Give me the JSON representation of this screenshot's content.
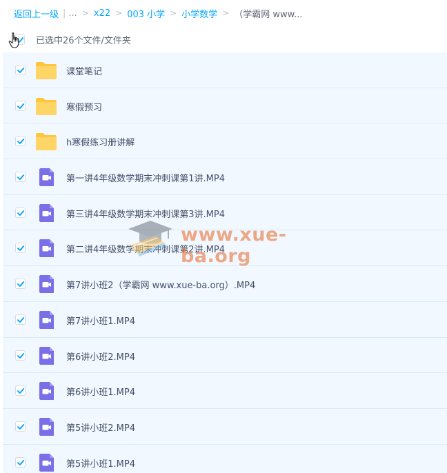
{
  "breadcrumb": {
    "back": "返回上一级",
    "ellipsis": "...",
    "items": [
      "x22",
      "003 小学",
      "小学数学"
    ],
    "current": "（学霸网 www..."
  },
  "selection": {
    "text": "已选中26个文件/文件夹"
  },
  "files": [
    {
      "name": "课堂笔记",
      "type": "folder"
    },
    {
      "name": "寒假预习",
      "type": "folder"
    },
    {
      "name": "h寒假练习册讲解",
      "type": "folder"
    },
    {
      "name": "第一讲4年级数学期末冲刺课第1讲.MP4",
      "type": "video"
    },
    {
      "name": "第三讲4年级数学期末冲刺课第3讲.MP4",
      "type": "video"
    },
    {
      "name": "第二讲4年级数学期末冲刺课第2讲.MP4",
      "type": "video"
    },
    {
      "name": "第7讲小班2（学霸网 www.xue-ba.org）.MP4",
      "type": "video"
    },
    {
      "name": "第7讲小班1.MP4",
      "type": "video"
    },
    {
      "name": "第6讲小班2.MP4",
      "type": "video"
    },
    {
      "name": "第6讲小班1.MP4",
      "type": "video"
    },
    {
      "name": "第5讲小班2.MP4",
      "type": "video"
    },
    {
      "name": "第5讲小班1.MP4",
      "type": "video"
    }
  ],
  "watermark": {
    "text": "www.xue-ba.org"
  },
  "colors": {
    "accent": "#06a7ff",
    "folder": "#ffc53d",
    "video": "#7b6fe8",
    "rowBg": "#f2f8ff"
  }
}
